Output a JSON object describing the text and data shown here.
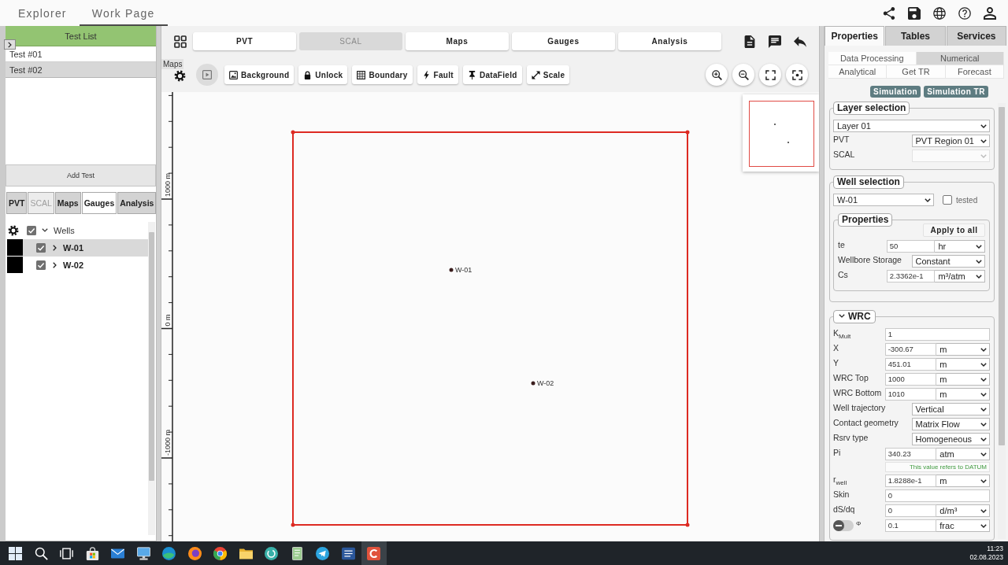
{
  "top_nav": {
    "tabs": [
      {
        "label": "Explorer",
        "selected": false
      },
      {
        "label": "Work Page",
        "selected": true
      }
    ]
  },
  "left_panel": {
    "title": "Test List",
    "tests": [
      {
        "label": "Test #01",
        "selected": false
      },
      {
        "label": "Test #02",
        "selected": true
      }
    ],
    "add_button": "Add Test",
    "tabs": [
      {
        "label": "PVT",
        "selected": false,
        "disabled": false
      },
      {
        "label": "SCAL",
        "selected": false,
        "disabled": true
      },
      {
        "label": "Maps",
        "selected": false,
        "disabled": false
      },
      {
        "label": "Gauges",
        "selected": true,
        "disabled": false
      },
      {
        "label": "Analysis",
        "selected": false,
        "disabled": false
      }
    ],
    "tree": {
      "label": "Wells",
      "checked": true,
      "expanded": true,
      "children": [
        {
          "label": "W-01",
          "checked": true,
          "expanded": false,
          "selected": true,
          "color": "#000000"
        },
        {
          "label": "W-02",
          "checked": true,
          "expanded": false,
          "selected": false,
          "color": "#000000"
        }
      ]
    }
  },
  "toolbar": {
    "tabs": [
      {
        "label": "PVT",
        "disabled": false
      },
      {
        "label": "SCAL",
        "disabled": true
      },
      {
        "label": "Maps",
        "disabled": false
      },
      {
        "label": "Gauges",
        "disabled": false
      },
      {
        "label": "Analysis",
        "disabled": false
      }
    ],
    "tooltip": "Maps",
    "tools": [
      {
        "kind": "image",
        "label": "Background"
      },
      {
        "kind": "lock",
        "label": "Unlock"
      },
      {
        "kind": "grid",
        "label": "Boundary"
      },
      {
        "kind": "bolt",
        "label": "Fault"
      },
      {
        "kind": "pin",
        "label": "DataField"
      },
      {
        "kind": "arrows",
        "label": "Scale"
      }
    ]
  },
  "map": {
    "ruler_labels": [
      "1000 m",
      "0 m",
      "-1000 m"
    ],
    "wells": [
      {
        "label": "W-01"
      },
      {
        "label": "W-02"
      }
    ]
  },
  "right_panel": {
    "tabs": [
      {
        "label": "Properties",
        "selected": true
      },
      {
        "label": "Tables",
        "selected": false
      },
      {
        "label": "Services",
        "selected": false
      }
    ],
    "subtab_rows": [
      [
        {
          "label": "Data Processing",
          "selected": false
        },
        {
          "label": "Numerical",
          "selected": true
        }
      ],
      [
        {
          "label": "Analytical",
          "selected": false
        },
        {
          "label": "Get TR",
          "selected": false
        },
        {
          "label": "Forecast",
          "selected": false
        }
      ]
    ],
    "actions": [
      "Simulation",
      "Simulation TR"
    ],
    "layer_selection": {
      "title": "Layer selection",
      "rows": [
        {
          "kind": "select_full",
          "value": "Layer 01",
          "disabled": false
        },
        {
          "kind": "select",
          "label": "PVT",
          "value": "PVT Region 01",
          "disabled": false
        },
        {
          "kind": "select",
          "label": "SCAL",
          "disabled": true
        }
      ]
    },
    "well_selection": {
      "title": "Well selection",
      "well": "W-01",
      "tested": {
        "label": "tested",
        "checked": false
      },
      "properties": {
        "title": "Properties",
        "apply_button": "Apply to all",
        "rows": [
          {
            "kind": "input_unit",
            "label": "te",
            "value": "50",
            "unit": "hr"
          },
          {
            "kind": "select",
            "label": "Wellbore Storage",
            "value": "Constant"
          },
          {
            "kind": "input_unit",
            "label": "Cs",
            "value": "2.3362e-1",
            "unit": "m³/atm"
          }
        ]
      }
    },
    "wrc": {
      "title": "WRC",
      "expanded": true,
      "rows": [
        {
          "kind": "input",
          "label": "K$_{Mult}$",
          "value": "1"
        },
        {
          "kind": "input_unit",
          "label": "X",
          "value": "-300.67",
          "unit": "m"
        },
        {
          "kind": "input_unit",
          "label": "Y",
          "value": "451.01",
          "unit": "m"
        },
        {
          "kind": "input_unit",
          "label": "WRC Top",
          "value": "1000",
          "unit": "m"
        },
        {
          "kind": "input_unit",
          "label": "WRC Bottom",
          "value": "1010",
          "unit": "m"
        },
        {
          "kind": "select",
          "label": "Well trajectory",
          "value": "Vertical"
        },
        {
          "kind": "select",
          "label": "Contact geometry",
          "value": "Matrix Flow"
        },
        {
          "kind": "select",
          "label": "Rsrv type",
          "value": "Homogeneous"
        },
        {
          "kind": "input_unit",
          "label": "Pi",
          "value": "340.23",
          "unit": "atm",
          "note": "This value refers to DATUM"
        },
        {
          "kind": "input_unit",
          "label": "r$_{well}$",
          "value": "1.8288e-1",
          "unit": "m"
        },
        {
          "kind": "input",
          "label": "Skin",
          "value": "0"
        },
        {
          "kind": "input_unit",
          "label": "dS/dq",
          "value": "0",
          "unit": "d/m³"
        },
        {
          "kind": "switch_unit",
          "label": "Φ",
          "on": false,
          "value": "0.1",
          "unit": "frac"
        }
      ]
    }
  },
  "taskbar": {
    "apps": [
      {
        "kind": "grid",
        "selected": false
      },
      {
        "kind": "search",
        "selected": false
      },
      {
        "kind": "taskview",
        "selected": false
      },
      {
        "kind": "bag",
        "selected": false
      },
      {
        "kind": "mail",
        "selected": false
      },
      {
        "kind": "monitor",
        "selected": false
      },
      {
        "kind": "wave",
        "selected": false
      },
      {
        "kind": "flame",
        "selected": false
      },
      {
        "kind": "segments",
        "selected": false
      },
      {
        "kind": "folder",
        "selected": false
      },
      {
        "kind": "disc",
        "selected": false
      },
      {
        "kind": "notebook",
        "selected": false
      },
      {
        "kind": "plane",
        "selected": false
      },
      {
        "kind": "doc",
        "selected": false
      },
      {
        "kind": "tile",
        "selected": true
      }
    ],
    "time": "11:23",
    "date": "02.08.2023"
  }
}
